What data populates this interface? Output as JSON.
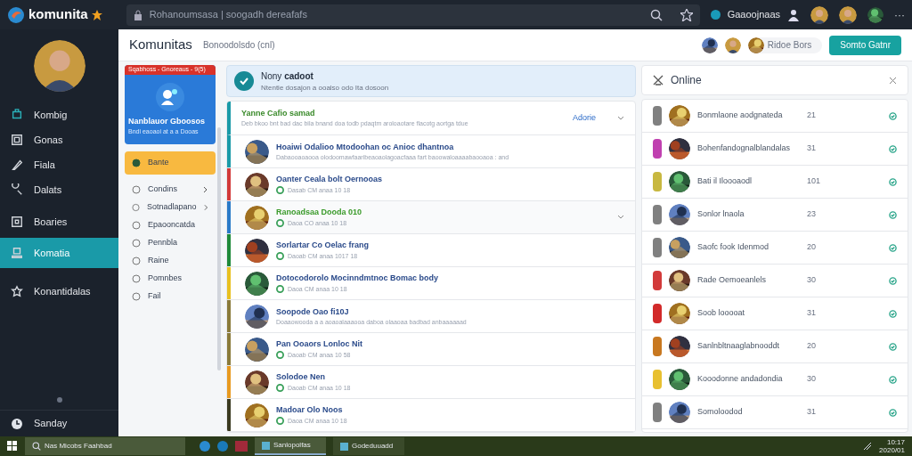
{
  "topbar": {
    "brand": "komunita",
    "search": {
      "placeholder": "Rohanoumsasa | soogadh dereafafs"
    },
    "status": "Gaaoojnaas",
    "more": "···"
  },
  "sidebar": {
    "items": [
      {
        "label": "Kombig",
        "selected": false
      },
      {
        "label": "Gonas",
        "selected": false
      },
      {
        "label": "Fiala",
        "selected": false
      },
      {
        "label": "Dalats",
        "selected": false
      },
      {
        "label": "Boaries",
        "selected": false
      },
      {
        "label": "Komatia",
        "selected": true
      },
      {
        "label": "Konantidalas",
        "selected": false
      }
    ],
    "footer": "Sanday"
  },
  "header": {
    "title": "Komunitas",
    "subtitle": "Bonoodolsdo (cnl)",
    "chip": "Ridoe Bors",
    "button": "Somto Gatnr"
  },
  "promo": {
    "strip": "Sqabhoss - Gnoreaus - 9(5)",
    "title": "Nanblauor Gboosos",
    "text": "Bndi eaoaoi at a a Dooas"
  },
  "menu": [
    {
      "label": "Bante",
      "selected": true,
      "has_children": false
    },
    {
      "label": "Condins",
      "selected": false,
      "has_children": true
    },
    {
      "label": "Sotnadlapano",
      "selected": false,
      "has_children": true
    },
    {
      "label": "Epaooncatda",
      "selected": false,
      "has_children": false
    },
    {
      "label": "Pennbla",
      "selected": false,
      "has_children": false
    },
    {
      "label": "Raine",
      "selected": false,
      "has_children": false
    },
    {
      "label": "Pomnbes",
      "selected": false,
      "has_children": false
    },
    {
      "label": "Fail",
      "selected": false,
      "has_children": false
    }
  ],
  "notice": {
    "title": "Nony **cadoot**",
    "text": "Ntentie dosajon a ooalso odo Ita dosoon"
  },
  "feed": {
    "title": "Yanne Cafio samad",
    "text": "Deb bkoo bnt bad dac bila bnand doa todb pdaqtm aroloaotare flacotg aortga tdue",
    "link": "Adorie",
    "threads": [
      {
        "title": "Hoaiwi Odalioo Mtodoohan oc Anioc dhantnoa",
        "kind": "description",
        "text": "Dabaooaoaooa olodoomawfaaribeaoaolagoacfaaa fart baoowaloaaaabaooaoa : and",
        "color": "#1a9aa8",
        "selected": false
      },
      {
        "title": "Oanter Ceala bolt Oernooas",
        "kind": "meta",
        "text": "Dasab CM anaa 10 18",
        "color": "#d23a3a",
        "selected": false
      },
      {
        "title": "Ranoadsaa Dooda 010",
        "kind": "meta",
        "text": "Daoa CO anaa 10 18",
        "color": "#2a7ac8",
        "selected": true
      },
      {
        "title": "Sorlartar Co Oelac frang",
        "kind": "meta",
        "text": "Daoab CM anaa 1017 18",
        "color": "#1f8a3a",
        "selected": false
      },
      {
        "title": "Dotocodorolo Mocinndmtnoc Bomac body",
        "kind": "meta",
        "text": "Daoa CM anaa 10 18",
        "color": "#e8c020",
        "selected": false
      },
      {
        "title": "Soopode Oao fi10J",
        "kind": "description",
        "text": "Doaaowooda a a aoaoalaaaooa daboa olaaoaa badbad anbaaaaaad",
        "color": "#8a7a3a",
        "selected": false
      },
      {
        "title": "Pan Ooaors Lonloc Nit",
        "kind": "meta",
        "text": "Daoab CM anaa 10 58",
        "color": "#8a7a3a",
        "selected": false
      },
      {
        "title": "Solodoe Nen",
        "kind": "meta",
        "text": "Daoab CM anaa 10 18",
        "color": "#e89a20",
        "selected": false
      },
      {
        "title": "Madoar Olo Noos",
        "kind": "meta",
        "text": "Daoa CM anaa 10 18",
        "color": "#3a3a20",
        "selected": false
      }
    ]
  },
  "online": {
    "title": "Online",
    "members": [
      {
        "name": "Bonmlaone aodgnateda",
        "count": "21",
        "color": "#808080"
      },
      {
        "name": "Bohenfandognalblandalas",
        "count": "31",
        "color": "#c040b0"
      },
      {
        "name": "Bati il Iloooaodl",
        "count": "101",
        "color": "#c8b840"
      },
      {
        "name": "Sonlor lnaola",
        "count": "23",
        "color": "#808080"
      },
      {
        "name": "Saofc fook Idenmod",
        "count": "20",
        "color": "#808080"
      },
      {
        "name": "Rade Oemoeanlels",
        "count": "30",
        "color": "#d23a3a"
      },
      {
        "name": "Soob looooat",
        "count": "31",
        "color": "#d22a2a"
      },
      {
        "name": "Sanlnbltnaaglabnooddt",
        "count": "20",
        "color": "#c87820"
      },
      {
        "name": "Kooodonne andadondia",
        "count": "30",
        "color": "#e8c030"
      },
      {
        "name": "Somoloodod",
        "count": "31",
        "color": "#808080"
      }
    ]
  },
  "taskbar": {
    "search": "Nas Micobs Faahbad",
    "apps": [
      {
        "label": "Sanlopolfas",
        "selected": true
      },
      {
        "label": "Godeduuadd",
        "selected": false
      }
    ],
    "time": "10:17",
    "date": "2020/01"
  }
}
